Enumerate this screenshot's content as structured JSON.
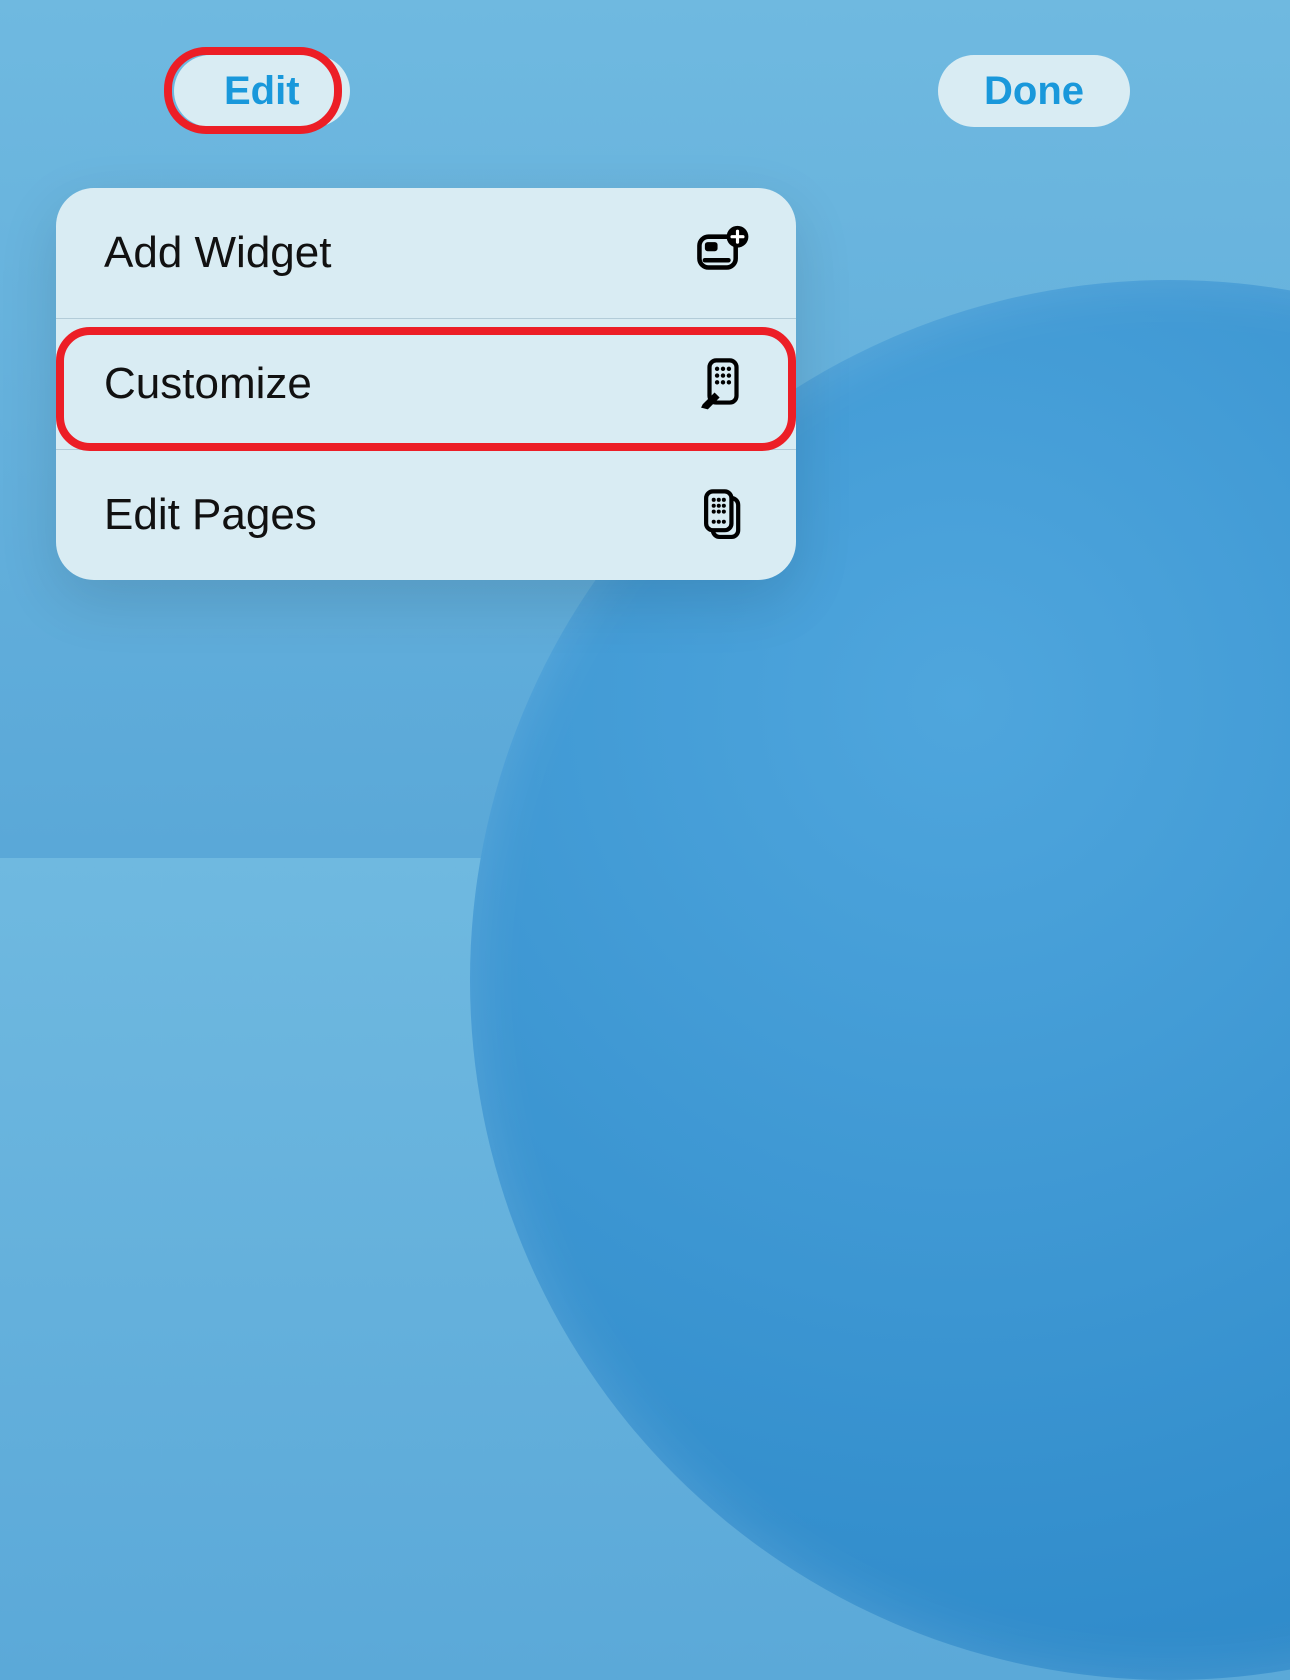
{
  "buttons": {
    "edit": "Edit",
    "done": "Done"
  },
  "menu": {
    "items": [
      {
        "label": "Add Widget",
        "icon": "add-widget-icon"
      },
      {
        "label": "Customize",
        "icon": "customize-icon"
      },
      {
        "label": "Edit Pages",
        "icon": "edit-pages-icon"
      }
    ]
  },
  "annotations": {
    "highlight_color": "#ec1e26",
    "highlighted": [
      "edit-button",
      "menu-item-customize"
    ]
  }
}
